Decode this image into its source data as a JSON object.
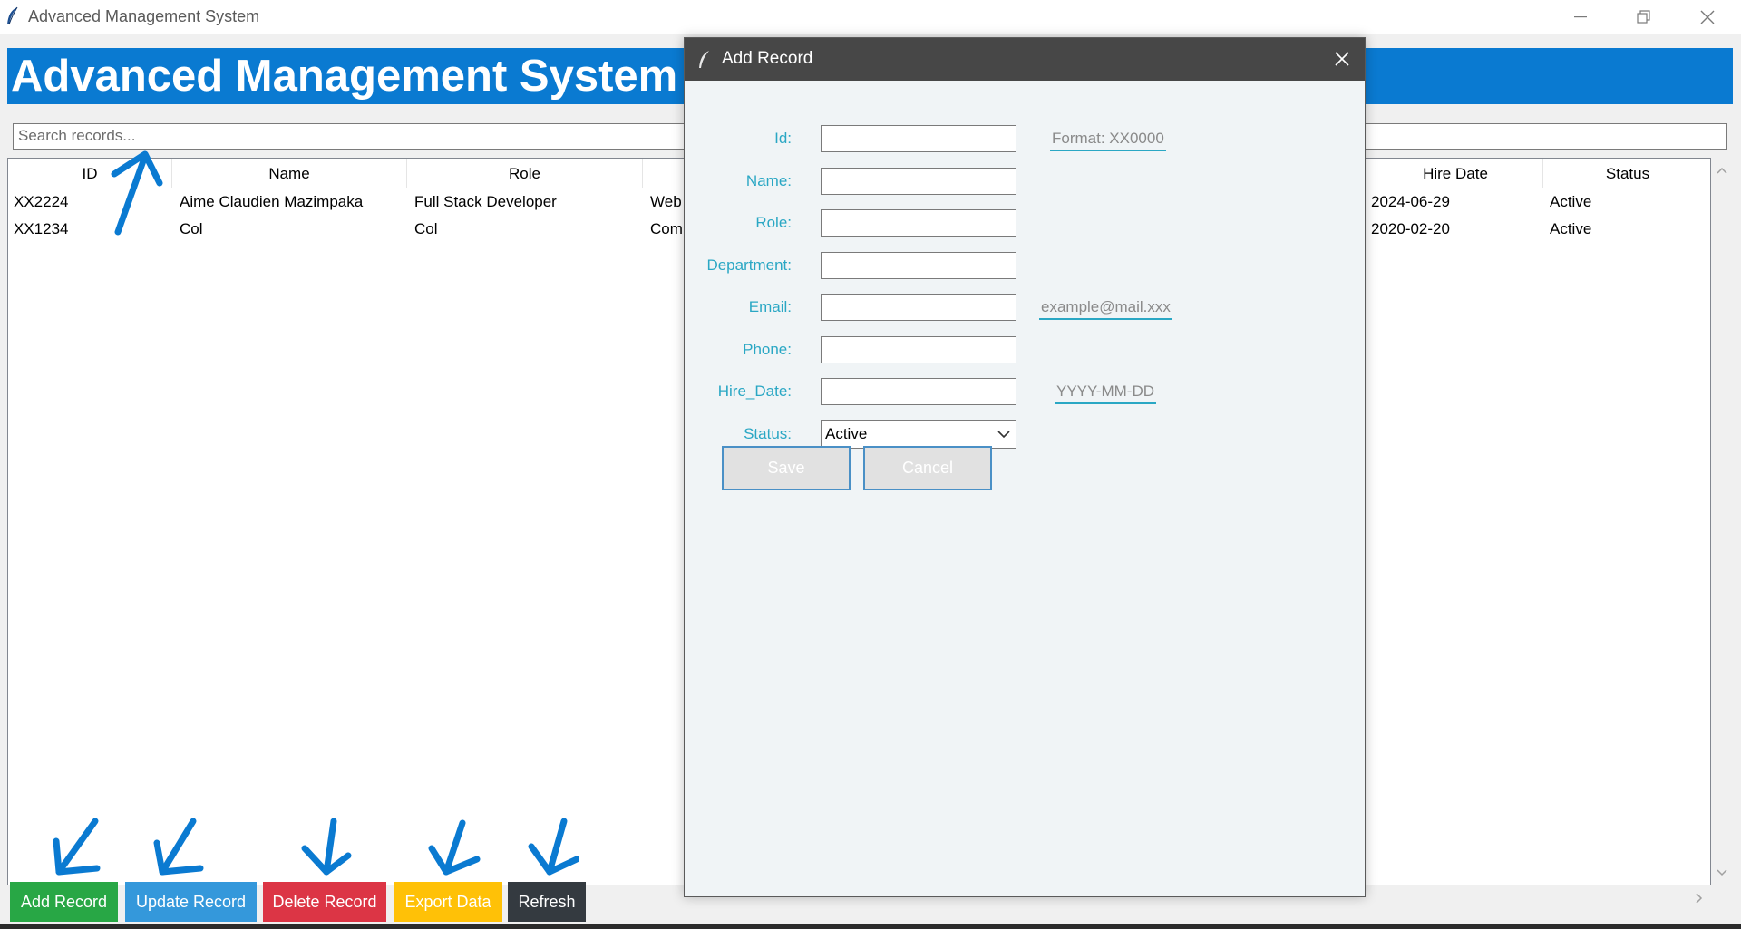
{
  "window": {
    "title": "Advanced Management System"
  },
  "app": {
    "banner_title": "Advanced Management System",
    "search_placeholder": "Search records...",
    "columns": [
      "ID",
      "Name",
      "Role",
      "",
      "Hire Date",
      "Status"
    ],
    "rows": [
      [
        "XX2224",
        "Aime Claudien Mazimpaka",
        "Full Stack Developer",
        "Web",
        "2024-06-29",
        "Active"
      ],
      [
        "XX1234",
        "Col",
        "Col",
        "Com",
        "2020-02-20",
        "Active"
      ]
    ],
    "buttons": {
      "add": "Add Record",
      "update": "Update Record",
      "delete": "Delete Record",
      "export": "Export Data",
      "refresh": "Refresh"
    }
  },
  "dialog": {
    "title": "Add Record",
    "fields": {
      "id": {
        "label": "Id:",
        "value": "",
        "hint": "Format: XX0000"
      },
      "name": {
        "label": "Name:",
        "value": ""
      },
      "role": {
        "label": "Role:",
        "value": ""
      },
      "department": {
        "label": "Department:",
        "value": ""
      },
      "email": {
        "label": "Email:",
        "value": "",
        "hint": "example@mail.xxx"
      },
      "phone": {
        "label": "Phone:",
        "value": ""
      },
      "hire_date": {
        "label": "Hire_Date:",
        "value": "",
        "hint": "YYYY-MM-DD"
      },
      "status": {
        "label": "Status:",
        "value": "Active"
      }
    },
    "save_label": "Save",
    "cancel_label": "Cancel"
  },
  "colors": {
    "banner": "#0a7ad1",
    "label": "#2aa7c4",
    "add": "#28a745",
    "update": "#3498db",
    "delete": "#dc3545",
    "export": "#ffc107",
    "refresh": "#343a40",
    "annotation_arrow": "#0a7ad1"
  }
}
